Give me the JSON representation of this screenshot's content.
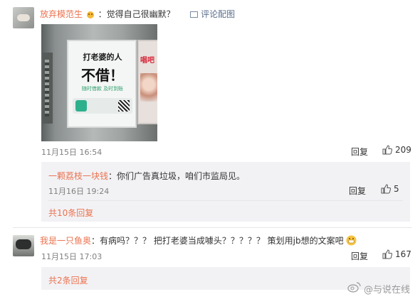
{
  "comments": [
    {
      "user": "放弃模范生",
      "text": "：觉得自己很幽默？",
      "view_image": "评论配图",
      "time": "11月15日 16:54",
      "reply_label": "回复",
      "likes": "209",
      "image_text": {
        "poster_left": "打老婆的人",
        "poster_big": "不借！",
        "poster_sub": "随时借款 及时到账",
        "poster_right": "唱吧"
      },
      "sub_reply": {
        "user": "一颗荔枝一块钱",
        "text": "：你们广告真垃圾，咱们市监局见。",
        "time": "11月16日 19:24",
        "reply_label": "回复",
        "likes": "5",
        "more": "共10条回复"
      }
    },
    {
      "user": "我是一只鱼奥",
      "text": "：有病吗？？？ 把打老婆当成噱头？？？？？ 策划用jb想的文案吧",
      "time": "11月15日 17:03",
      "reply_label": "回复",
      "likes": "167",
      "more": "共2条回复"
    }
  ],
  "watermark": "@与说在线",
  "colors": {
    "accent": "#eb7350",
    "reply_bg": "#f2f2f5"
  }
}
